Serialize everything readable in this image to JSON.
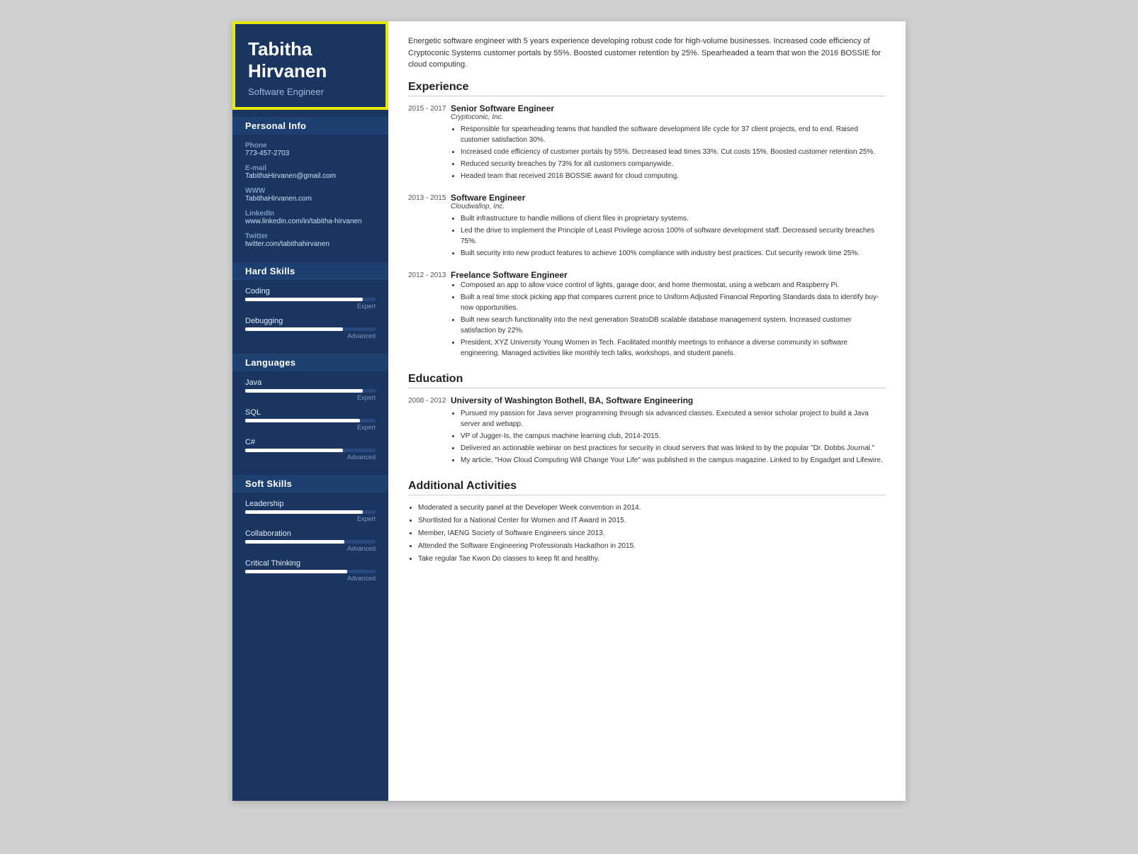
{
  "sidebar": {
    "name": "Tabitha Hirvanen",
    "name_line1": "Tabitha",
    "name_line2": "Hirvanen",
    "title": "Software Engineer",
    "personal_info_label": "Personal Info",
    "phone_label": "Phone",
    "phone": "773-457-2703",
    "email_label": "E-mail",
    "email": "TabithaHirvanen@gmail.com",
    "www_label": "WWW",
    "www": "TabithaHirvanen.com",
    "linkedin_label": "LinkedIn",
    "linkedin": "www.linkedin.com/in/tabitha-hirvanen",
    "twitter_label": "Twitter",
    "twitter": "twitter.com/tabithahirvanen",
    "hard_skills_label": "Hard Skills",
    "coding_label": "Coding",
    "coding_level": "Expert",
    "coding_pct": 90,
    "debugging_label": "Debugging",
    "debugging_level": "Advanced",
    "debugging_pct": 75,
    "languages_label": "Languages",
    "java_label": "Java",
    "java_level": "Expert",
    "java_pct": 90,
    "sql_label": "SQL",
    "sql_level": "Expert",
    "sql_pct": 88,
    "csharp_label": "C#",
    "csharp_level": "Advanced",
    "csharp_pct": 75,
    "soft_skills_label": "Soft Skills",
    "leadership_label": "Leadership",
    "leadership_level": "Expert",
    "leadership_pct": 90,
    "collaboration_label": "Collaboration",
    "collaboration_level": "Advanced",
    "collaboration_pct": 76,
    "critical_label": "Critical Thinking",
    "critical_level": "Advanced",
    "critical_pct": 78
  },
  "main": {
    "summary": "Energetic software engineer with 5 years experience developing robust code for high-volume businesses. Increased code efficiency of Cryptoconic Systems customer portals by 55%. Boosted customer retention by 25%. Spearheaded a team that won the 2016 BOSSIE for cloud computing.",
    "experience_label": "Experience",
    "jobs": [
      {
        "dates": "2015 - 2017",
        "title": "Senior Software Engineer",
        "company": "Cryptoconic, Inc.",
        "bullets": [
          "Responsible for spearheading teams that handled the software development life cycle for 37 client projects, end to end. Raised customer satisfaction 30%.",
          "Increased code efficiency of customer portals by 55%. Decreased lead times 33%. Cut costs 15%. Boosted customer retention 25%.",
          "Reduced security breaches by 73% for all customers companywide.",
          "Headed team that received 2016 BOSSIE award for cloud computing."
        ]
      },
      {
        "dates": "2013 - 2015",
        "title": "Software Engineer",
        "company": "Cloudwallop, Inc.",
        "bullets": [
          "Built infrastructure to handle millions of client files in proprietary systems.",
          "Led the drive to implement the Principle of Least Privilege across 100% of software development staff. Decreased security breaches 75%.",
          "Built security into new product features to achieve 100% compliance with industry best practices. Cut security rework time 25%."
        ]
      },
      {
        "dates": "2012 - 2013",
        "title": "Freelance Software Engineer",
        "company": "",
        "bullets": [
          "Composed an app to allow voice control of lights, garage door, and home thermostat, using a webcam and Raspberry Pi.",
          "Built a real time stock picking app that compares current price to Uniform Adjusted Financial Reporting Standards data to identify buy-now opportunities.",
          "Built new search functionality into the next generation StratoDB scalable database management system. Increased customer satisfaction by 22%.",
          "President, XYZ University Young Women in Tech. Facilitated monthly meetings to enhance a diverse community in software engineering. Managed activities like monthly tech talks, workshops, and student panels."
        ]
      }
    ],
    "education_label": "Education",
    "education": [
      {
        "dates": "2008 - 2012",
        "title": "University of Washington Bothell, BA, Software Engineering",
        "bullets": [
          "Pursued my passion for Java server programming through six advanced classes. Executed a senior scholar project to build a Java server and webapp.",
          "VP of Jugger-Is, the campus machine learning club, 2014-2015.",
          "Delivered an actionable webinar on best practices for security in cloud servers that was linked to by the popular \"Dr. Dobbs Journal.\"",
          "My article, \"How Cloud Computing Will Change Your Life\" was published in the campus magazine. Linked to by Engadget and Lifewire."
        ]
      }
    ],
    "activities_label": "Additional Activities",
    "activities": [
      "Moderated a security panel at the Developer Week convention in 2014.",
      "Shortlisted for a National Center for Women and IT Award in 2015.",
      "Member, IAENG Society of Software Engineers since 2013.",
      "Attended the Software Engineering Professionals Hackathon in 2015.",
      "Take regular Tae Kwon Do classes to keep fit and healthy."
    ]
  }
}
